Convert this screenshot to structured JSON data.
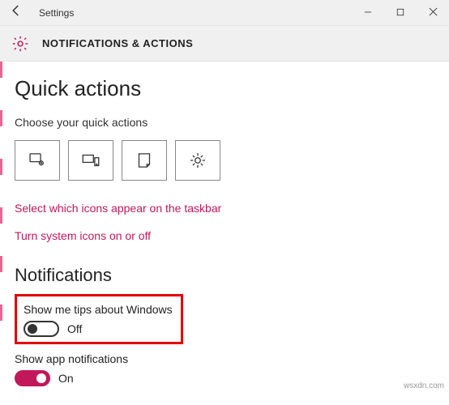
{
  "window": {
    "title": "Settings"
  },
  "header": {
    "crumb": "NOTIFICATIONS & ACTIONS"
  },
  "quick_actions": {
    "heading": "Quick actions",
    "sub": "Choose your quick actions",
    "link_taskbar": "Select which icons appear on the taskbar",
    "link_sysicons": "Turn system icons on or off"
  },
  "notifications": {
    "heading": "Notifications",
    "tips_label": "Show me tips about Windows",
    "tips_state": "Off",
    "app_label": "Show app notifications",
    "app_state": "On"
  },
  "watermark": "wsxdn.com"
}
